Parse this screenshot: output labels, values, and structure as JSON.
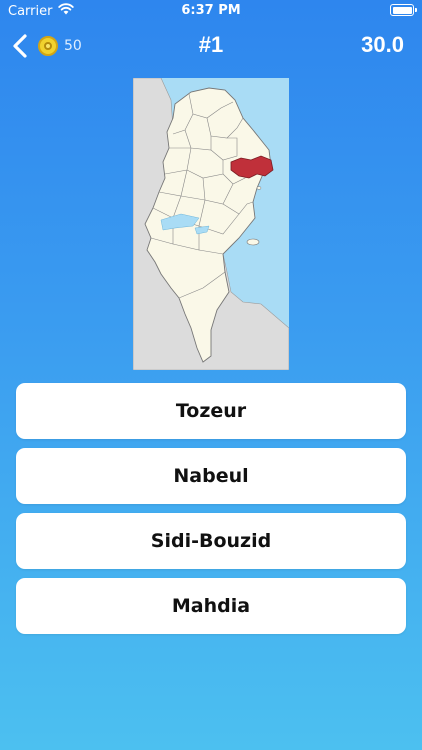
{
  "status_bar": {
    "carrier": "Carrier",
    "time": "6:37 PM",
    "wifi_icon": "wifi-icon",
    "battery_icon": "battery-icon"
  },
  "nav": {
    "back_icon": "chevron-left-icon",
    "coin_icon": "coin-icon",
    "coins": "50",
    "question_number": "#1",
    "timer": "30.0"
  },
  "map": {
    "highlight_color": "#c0303a",
    "land_color": "#faf8e8",
    "sea_color": "#a9dcf5",
    "neighbor_color": "#dcdcdc"
  },
  "answers": [
    {
      "label": "Tozeur"
    },
    {
      "label": "Nabeul"
    },
    {
      "label": "Sidi-Bouzid"
    },
    {
      "label": "Mahdia"
    }
  ],
  "colors": {
    "gradient_top": "#2e86ee",
    "gradient_bottom": "#4cc0f0"
  }
}
